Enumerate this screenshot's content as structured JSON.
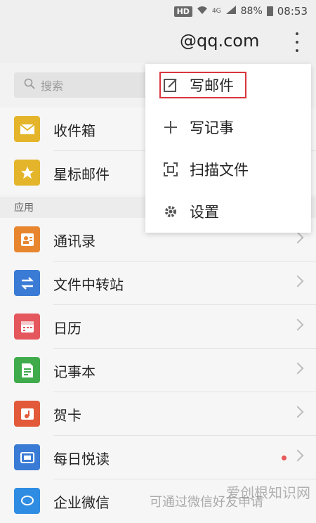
{
  "status_bar": {
    "hd": "HD",
    "network": "4G",
    "battery": "88%",
    "time": "08:53"
  },
  "header": {
    "account": "@qq.com"
  },
  "search": {
    "placeholder": "搜索"
  },
  "mailboxes": [
    {
      "label": "收件箱",
      "color": "#e4b52b"
    },
    {
      "label": "星标邮件",
      "color": "#e4b52b"
    }
  ],
  "section_apps": "应用",
  "apps": [
    {
      "label": "通讯录",
      "color": "#e8862f"
    },
    {
      "label": "文件中转站",
      "color": "#3a7bd5"
    },
    {
      "label": "日历",
      "color": "#e4575d"
    },
    {
      "label": "记事本",
      "color": "#3fab4b"
    },
    {
      "label": "贺卡",
      "color": "#e25a3a"
    },
    {
      "label": "每日悦读",
      "color": "#3a7bd5"
    },
    {
      "label": "企业微信",
      "color": "#2f8ce3",
      "note": "可通过微信好友申请"
    }
  ],
  "menu": [
    {
      "label": "写邮件",
      "icon": "edit-icon"
    },
    {
      "label": "写记事",
      "icon": "plus-icon"
    },
    {
      "label": "扫描文件",
      "icon": "scan-icon"
    },
    {
      "label": "设置",
      "icon": "gear-icon"
    }
  ],
  "watermark": "爱创根知识网"
}
